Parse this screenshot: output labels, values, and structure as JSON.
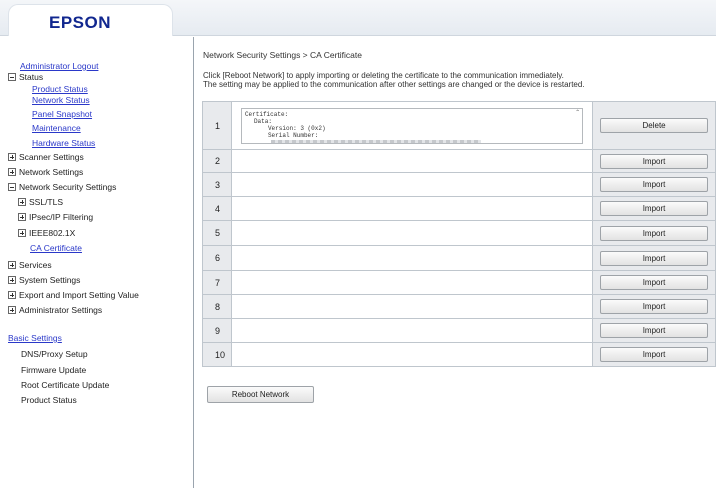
{
  "brand": {
    "logo_text": "EPSON"
  },
  "sidebar": {
    "admin_logout": "Administrator Logout",
    "status": {
      "label": "Status",
      "items": [
        "Product Status",
        "Network Status",
        "Panel Snapshot",
        "Maintenance",
        "Hardware Status"
      ]
    },
    "scanner_settings": "Scanner Settings",
    "network_settings": "Network Settings",
    "network_security_settings": "Network Security Settings",
    "security_items": [
      "SSL/TLS",
      "IPsec/IP Filtering",
      "IEEE802.1X"
    ],
    "ca_certificate": "CA Certificate",
    "services": "Services",
    "system_settings": "System Settings",
    "export_import": "Export and Import Setting Value",
    "administrator_settings": "Administrator Settings",
    "basic_settings": "Basic Settings",
    "basic_items": [
      "DNS/Proxy Setup",
      "Firmware Update",
      "Root Certificate Update",
      "Product Status"
    ]
  },
  "main": {
    "breadcrumb": "Network Security Settings > CA Certificate",
    "description_line1": "Click [Reboot Network] to apply importing or deleting the certificate to the communication immediately.",
    "description_line2": "The setting may be applied to the communication after other settings are changed or the device is restarted.",
    "certificate_text": {
      "line1": "Certificate:",
      "line2": "Data:",
      "line3": "Version: 3 (0x2)",
      "line4": "Serial Number:"
    },
    "rows": [
      {
        "num": "1",
        "action": "Delete"
      },
      {
        "num": "2",
        "action": "Import"
      },
      {
        "num": "3",
        "action": "Import"
      },
      {
        "num": "4",
        "action": "Import"
      },
      {
        "num": "5",
        "action": "Import"
      },
      {
        "num": "6",
        "action": "Import"
      },
      {
        "num": "7",
        "action": "Import"
      },
      {
        "num": "8",
        "action": "Import"
      },
      {
        "num": "9",
        "action": "Import"
      },
      {
        "num": "10",
        "action": "Import"
      }
    ],
    "reboot_button": "Reboot Network"
  }
}
